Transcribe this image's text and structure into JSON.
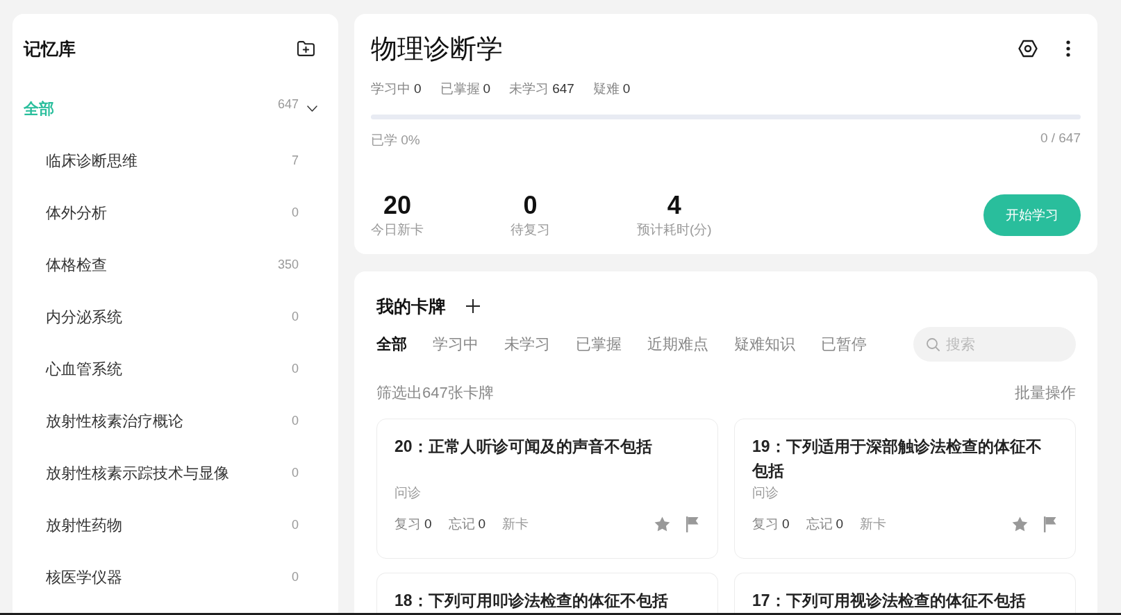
{
  "sidebar": {
    "title": "记忆库",
    "items": [
      {
        "label": "全部",
        "count": "647",
        "selected": true,
        "expanded": true,
        "children": [
          {
            "label": "临床诊断思维",
            "count": "7",
            "selected": false
          },
          {
            "label": "体外分析",
            "count": "0",
            "selected": false
          },
          {
            "label": "体格检查",
            "count": "350",
            "selected": false
          },
          {
            "label": "内分泌系统",
            "count": "0",
            "selected": false
          },
          {
            "label": "心血管系统",
            "count": "0",
            "selected": false
          },
          {
            "label": "放射性核素治疗概论",
            "count": "0",
            "selected": false
          },
          {
            "label": "放射性核素示踪技术与显像",
            "count": "0",
            "selected": false
          },
          {
            "label": "放射性药物",
            "count": "0",
            "selected": false
          },
          {
            "label": "核医学仪器",
            "count": "0",
            "selected": false
          }
        ]
      }
    ]
  },
  "deck": {
    "title": "物理诊断学",
    "stats": [
      {
        "label": "学习中",
        "value": "0"
      },
      {
        "label": "已掌握",
        "value": "0"
      },
      {
        "label": "未学习",
        "value": "647"
      },
      {
        "label": "疑难",
        "value": "0"
      }
    ],
    "progress": {
      "level": 0,
      "label": "已学 0%",
      "count": "0 / 647"
    },
    "today": [
      {
        "value": "20",
        "label": "今日新卡"
      },
      {
        "value": "0",
        "label": "待复习"
      },
      {
        "value": "4",
        "label": "预计耗时(分)"
      }
    ],
    "start_button": "开始学习"
  },
  "cards_panel": {
    "title": "我的卡牌",
    "tabs": [
      {
        "label": "全部",
        "selected": true
      },
      {
        "label": "学习中",
        "selected": false
      },
      {
        "label": "未学习",
        "selected": false
      },
      {
        "label": "已掌握",
        "selected": false
      },
      {
        "label": "近期难点",
        "selected": false
      },
      {
        "label": "疑难知识",
        "selected": false
      },
      {
        "label": "已暂停",
        "selected": false
      }
    ],
    "search": {
      "placeholder": "搜索"
    },
    "filter_summary": "筛选出647张卡牌",
    "batch_action": "批量操作",
    "cards": [
      {
        "title": "20：正常人听诊可闻及的声音不包括",
        "tag": "问诊",
        "stats": [
          {
            "label": "复习",
            "value": "0"
          },
          {
            "label": "忘记",
            "value": "0"
          }
        ],
        "status": "新卡",
        "starred": false,
        "flagged": false
      },
      {
        "title": "19：下列适用于深部触诊法检查的体征不包括",
        "tag": "问诊",
        "stats": [
          {
            "label": "复习",
            "value": "0"
          },
          {
            "label": "忘记",
            "value": "0"
          }
        ],
        "status": "新卡",
        "starred": false,
        "flagged": false
      },
      {
        "title": "18：下列可用叩诊法检查的体征不包括"
      },
      {
        "title": "17：下列可用视诊法检查的体征不包括"
      }
    ]
  }
}
